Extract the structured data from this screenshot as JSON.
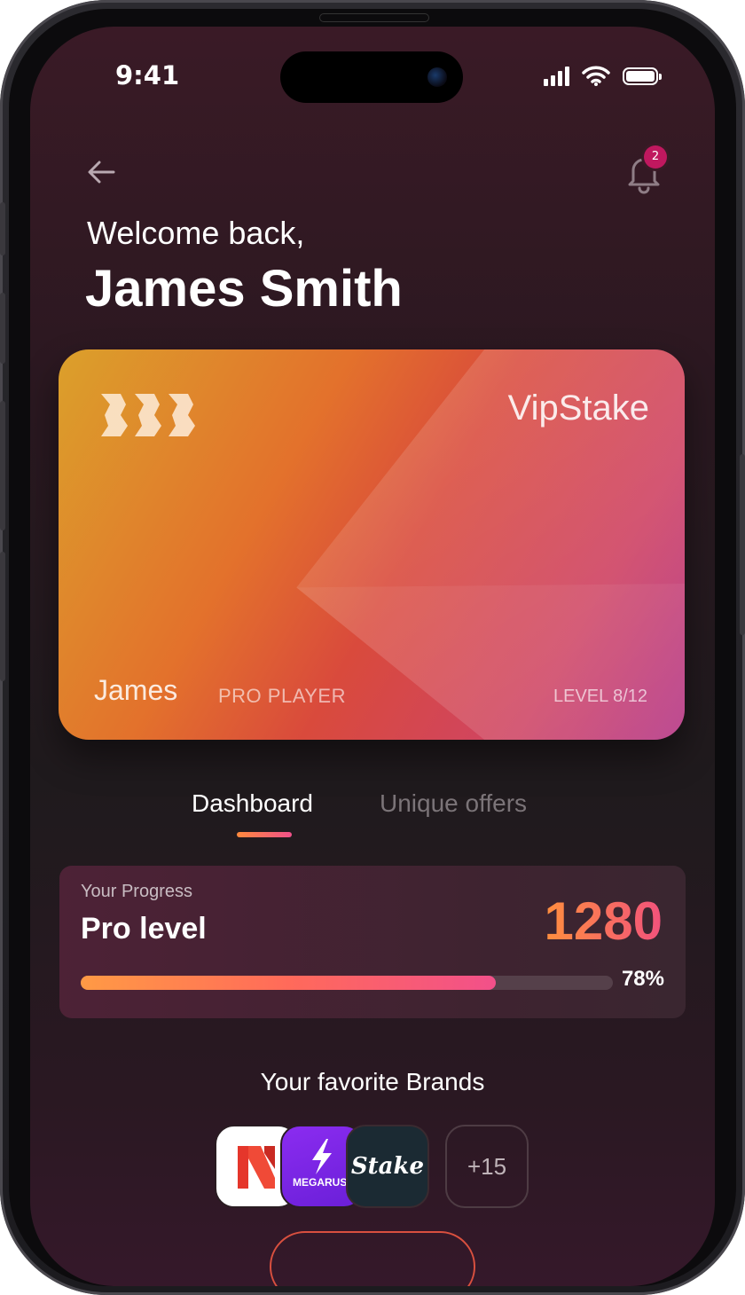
{
  "status_bar": {
    "time": "9:41",
    "icons": [
      "cellular-signal-icon",
      "wifi-icon",
      "battery-icon"
    ]
  },
  "header": {
    "back_icon": "arrow-left-icon",
    "notification_icon": "bell-icon",
    "notification_count": "2",
    "greeting": "Welcome back,",
    "user_name": "James Smith"
  },
  "card": {
    "logo_icon": "vipstake-logo-icon",
    "brand": "VipStake",
    "holder": "James",
    "rank": "PRO PLAYER",
    "level": "LEVEL 8/12"
  },
  "tabs": [
    {
      "label": "Dashboard",
      "active": true
    },
    {
      "label": "Unique offers",
      "active": false
    }
  ],
  "progress": {
    "label": "Your Progress",
    "level": "Pro level",
    "points": "1280",
    "percent_text": "78%",
    "fill_fraction": 0.78
  },
  "brands": {
    "title": "Your favorite Brands",
    "items": [
      {
        "name": "n-brand-logo-icon"
      },
      {
        "name": "megarush-logo-icon",
        "label": "MEGARUSH"
      },
      {
        "name": "stake-logo-icon",
        "label": "Stake"
      }
    ],
    "more": "+15"
  },
  "colors": {
    "accent_orange": "#ff8a3d",
    "accent_pink": "#f0508a",
    "badge": "#c0185f"
  }
}
